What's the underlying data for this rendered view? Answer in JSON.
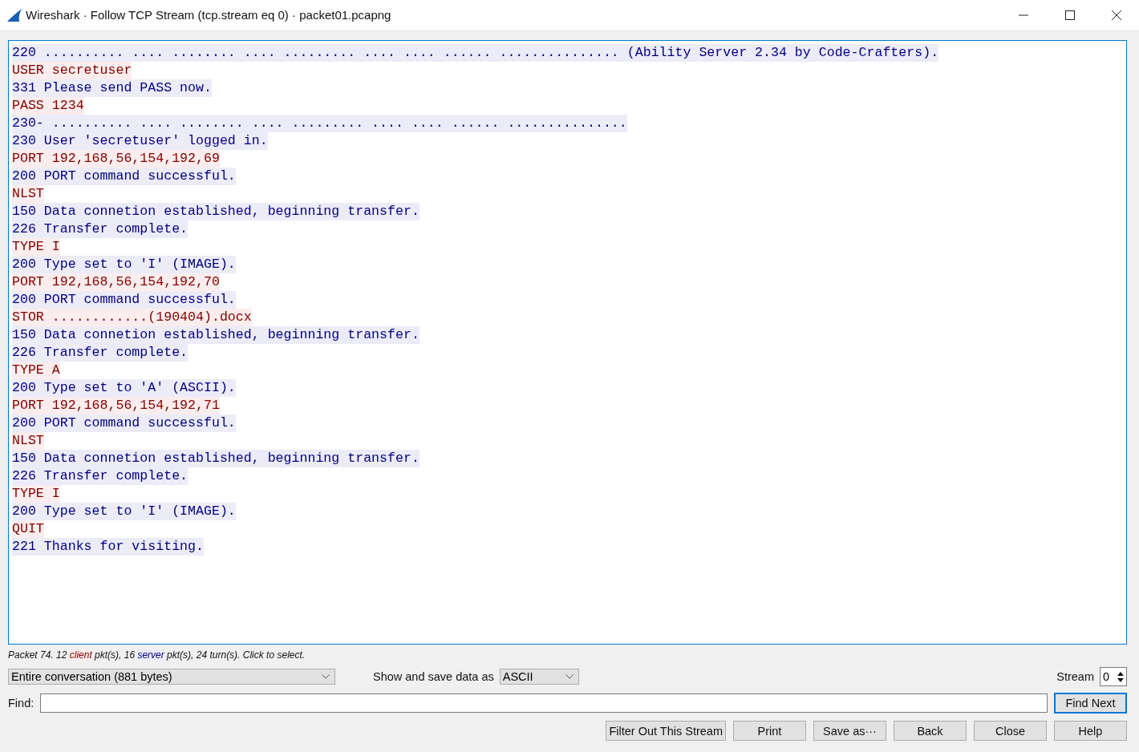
{
  "window": {
    "title": "Wireshark · Follow TCP Stream (tcp.stream eq 0) · packet01.pcapng"
  },
  "stream_lines": [
    {
      "kind": "server",
      "text": "220 .......... .... ........ .... ......... .... .... ...... ............... (Ability Server 2.34 by Code-Crafters)."
    },
    {
      "kind": "client",
      "text": "USER secretuser"
    },
    {
      "kind": "server",
      "text": "331 Please send PASS now."
    },
    {
      "kind": "client",
      "text": "PASS 1234"
    },
    {
      "kind": "server",
      "text": "230- .......... .... ........ .... ......... .... .... ...... ..............."
    },
    {
      "kind": "server",
      "text": "230 User 'secretuser' logged in."
    },
    {
      "kind": "client",
      "text": "PORT 192,168,56,154,192,69"
    },
    {
      "kind": "server",
      "text": "200 PORT command successful."
    },
    {
      "kind": "client",
      "text": "NLST"
    },
    {
      "kind": "server",
      "text": "150 Data connetion established, beginning transfer."
    },
    {
      "kind": "server",
      "text": "226 Transfer complete."
    },
    {
      "kind": "client",
      "text": "TYPE I"
    },
    {
      "kind": "server",
      "text": "200 Type set to 'I' (IMAGE)."
    },
    {
      "kind": "client",
      "text": "PORT 192,168,56,154,192,70"
    },
    {
      "kind": "server",
      "text": "200 PORT command successful."
    },
    {
      "kind": "client",
      "text": "STOR ............(190404).docx"
    },
    {
      "kind": "server",
      "text": "150 Data connetion established, beginning transfer."
    },
    {
      "kind": "server",
      "text": "226 Transfer complete."
    },
    {
      "kind": "client",
      "text": "TYPE A"
    },
    {
      "kind": "server",
      "text": "200 Type set to 'A' (ASCII)."
    },
    {
      "kind": "client",
      "text": "PORT 192,168,56,154,192,71"
    },
    {
      "kind": "server",
      "text": "200 PORT command successful."
    },
    {
      "kind": "client",
      "text": "NLST"
    },
    {
      "kind": "server",
      "text": "150 Data connetion established, beginning transfer."
    },
    {
      "kind": "server",
      "text": "226 Transfer complete."
    },
    {
      "kind": "client",
      "text": "TYPE I"
    },
    {
      "kind": "server",
      "text": "200 Type set to 'I' (IMAGE)."
    },
    {
      "kind": "client",
      "text": "QUIT"
    },
    {
      "kind": "server",
      "text": "221 Thanks for visiting."
    }
  ],
  "status": {
    "prefix": "Packet 74. 12 ",
    "client": "client",
    "middle": " pkt(s), 16 ",
    "server": "server",
    "suffix": " pkt(s), 24 turn(s). Click to select."
  },
  "conversation_select": {
    "value": "Entire conversation (881 bytes)"
  },
  "show_as": {
    "label": "Show and save data as",
    "value": "ASCII"
  },
  "stream": {
    "label": "Stream",
    "value": "0"
  },
  "find": {
    "label": "Find:",
    "button": "Find Next"
  },
  "buttons": [
    "Filter Out This Stream",
    "Print",
    "Save as···",
    "Back",
    "Close",
    "Help"
  ]
}
